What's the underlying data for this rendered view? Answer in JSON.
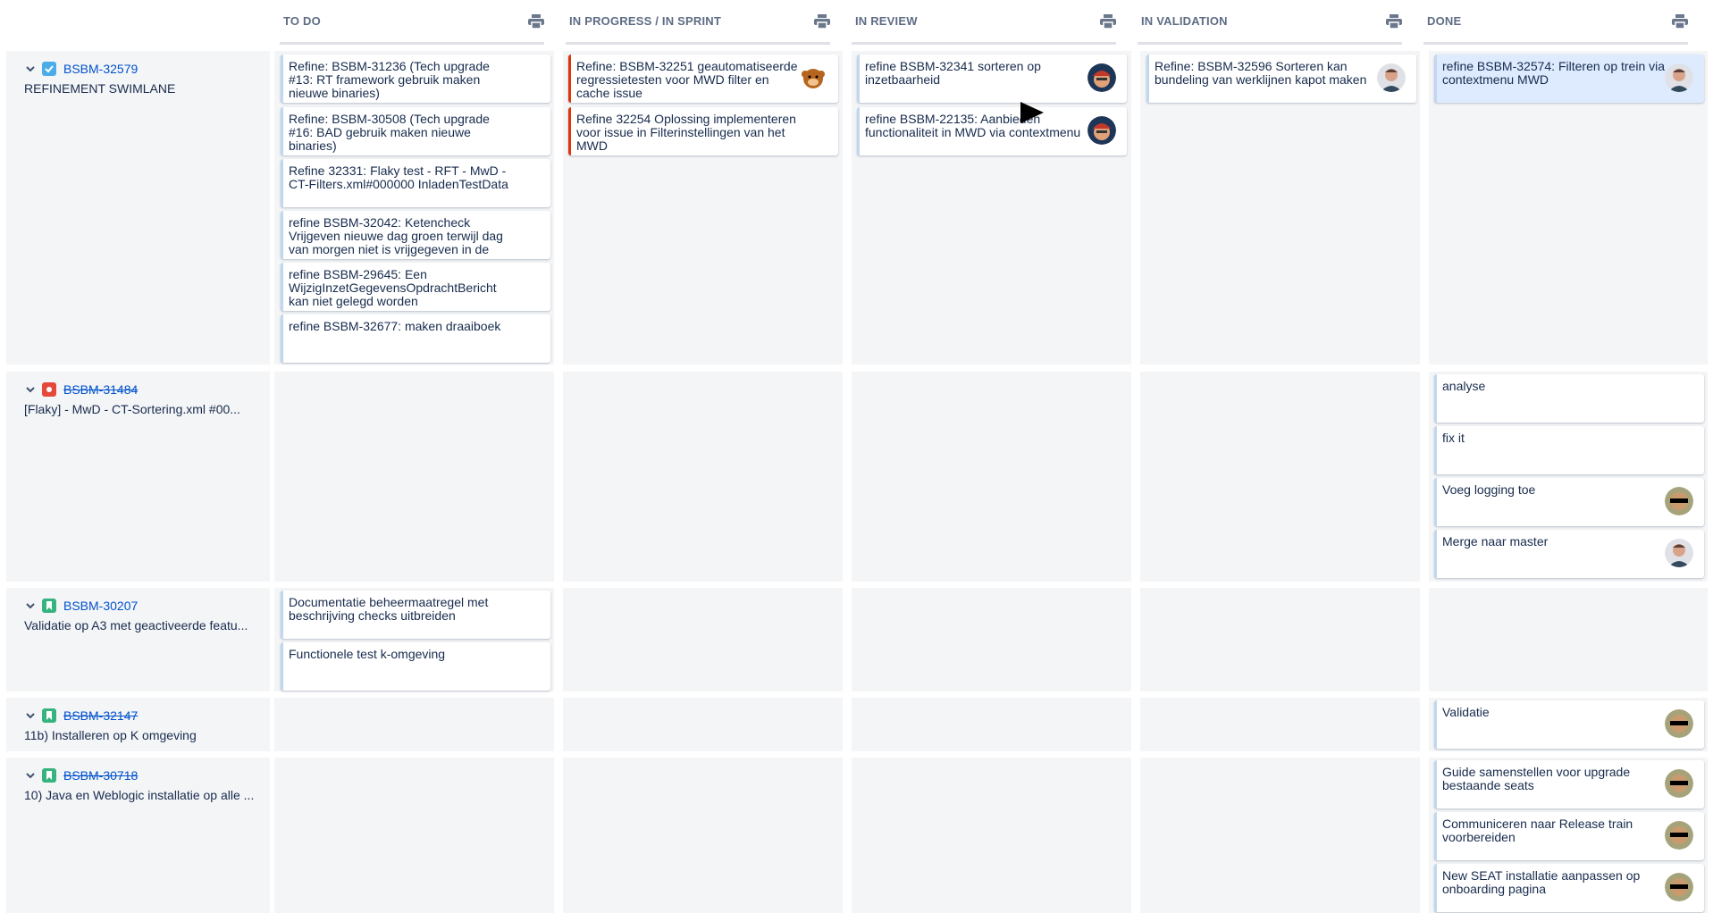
{
  "columns": [
    {
      "name": "TO DO"
    },
    {
      "name": "IN PROGRESS / IN SPRINT"
    },
    {
      "name": "IN REVIEW"
    },
    {
      "name": "IN VALIDATION"
    },
    {
      "name": "DONE"
    }
  ],
  "swimlanes": [
    {
      "key": "BSBM-32579",
      "summary": "REFINEMENT SWIMLANE",
      "type": "task"
    },
    {
      "key": "BSBM-31484",
      "summary": "[Flaky] - MwD - CT-Sortering.xml #00...",
      "type": "bug"
    },
    {
      "key": "BSBM-30207",
      "summary": "Validatie op A3 met geactiveerde featu...",
      "type": "story"
    },
    {
      "key": "BSBM-32147",
      "summary": "11b) Installeren op K omgeving",
      "type": "story"
    },
    {
      "key": "BSBM-30718",
      "summary": "10) Java en Weblogic installatie op alle ...",
      "type": "story"
    }
  ],
  "cards": {
    "lane1_todo": [
      "Refine: BSBM-31236 (Tech upgrade #13: RT framework gebruik maken nieuwe binaries)",
      "Refine: BSBM-30508 (Tech upgrade #16: BAD gebruik maken nieuwe binaries)",
      "Refine 32331: Flaky test - RFT - MwD - CT-Filters.xml#000000 InladenTestData",
      "refine BSBM-32042: Ketencheck Vrijgeven nieuwe dag groen terwijl dag van morgen niet is vrijgegeven in de",
      "refine BSBM-29645: Een WijzigInzetGegevensOpdrachtBericht kan niet gelegd worden",
      "refine BSBM-32677: maken draaiboek"
    ],
    "lane1_inprogress": [
      "Refine: BSBM-32251 geautomatiseerde regressietesten voor MWD filter en cache issue",
      "Refine 32254 Oplossing implementeren voor issue in Filterinstellingen van het MWD"
    ],
    "lane1_review": [
      "refine BSBM-32341 sorteren op inzetbaarheid",
      "refine BSBM-22135: Aanbieden functionaliteit in MWD via contextmenu"
    ],
    "lane1_validation": [
      "Refine: BSBM-32596 Sorteren kan bundeling van werklijnen kapot maken"
    ],
    "lane1_done": [
      "refine BSBM-32574: Filteren op trein via contextmenu MWD"
    ],
    "lane2_done": [
      "analyse",
      "fix it",
      "Voeg logging toe",
      "Merge naar master"
    ],
    "lane3_todo": [
      "Documentatie beheermaatregel met beschrijving checks uitbreiden",
      "Functionele test k-omgeving"
    ],
    "lane4_done": [
      "Validatie"
    ],
    "lane5_done": [
      "Guide samenstellen voor upgrade bestaande seats",
      "Communiceren naar Release train voorbereiden",
      "New SEAT installatie aanpassen op onboarding pagina"
    ]
  },
  "icons": {
    "print": "printer-icon",
    "collapse": "chevron-down-icon",
    "task": "checkbox-icon",
    "bug": "bug-icon",
    "story": "bookmark-icon"
  },
  "colors": {
    "link": "#0052cc",
    "task": "#4bade8",
    "bug": "#e5493a",
    "story": "#36b37e",
    "flag": "#de350b",
    "lane_bg": "#f4f5f7"
  }
}
